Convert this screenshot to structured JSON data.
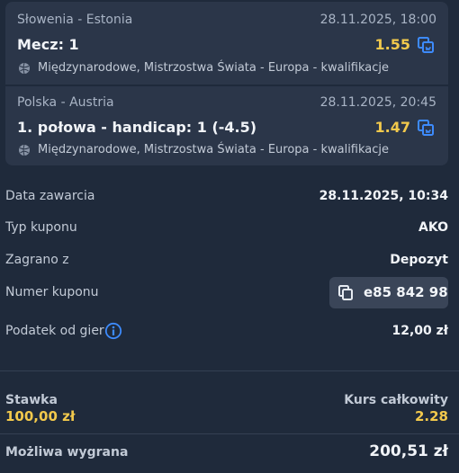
{
  "bets": [
    {
      "teams": "Słowenia - Estonia",
      "datetime": "28.11.2025, 18:00",
      "market": "Mecz: 1",
      "odds": "1.55",
      "league": "Międzynarodowe, Mistrzostwa Świata - Europa - kwalifikacje"
    },
    {
      "teams": "Polska - Austria",
      "datetime": "28.11.2025, 20:45",
      "market": "1. połowa - handicap: 1 (-4.5)",
      "odds": "1.47",
      "league": "Międzynarodowe, Mistrzostwa Świata - Europa - kwalifikacje"
    }
  ],
  "details": {
    "date_label": "Data zawarcia",
    "date_value": "28.11.2025, 10:34",
    "type_label": "Typ kuponu",
    "type_value": "AKO",
    "played_label": "Zagrano z",
    "played_value": "Depozyt",
    "coupon_label": "Numer kuponu",
    "coupon_value": "e85 842 98",
    "tax_label": "Podatek od gier",
    "tax_value": "12,00 zł"
  },
  "summary": {
    "stake_label": "Stawka",
    "stake_value": "100,00 zł",
    "total_odds_label": "Kurs całkowity",
    "total_odds_value": "2.28",
    "win_label": "Możliwa wygrana",
    "win_value": "200,51 zł"
  },
  "colors": {
    "background": "#1f2a3b",
    "card": "#2b3649",
    "accent_yellow": "#f2c94c",
    "accent_blue": "#3d8bfd"
  },
  "icons": {
    "bet_copy": "copy-to-betslip-icon",
    "league": "football-icon",
    "info": "info-icon",
    "coupon_copy": "copy-icon"
  }
}
